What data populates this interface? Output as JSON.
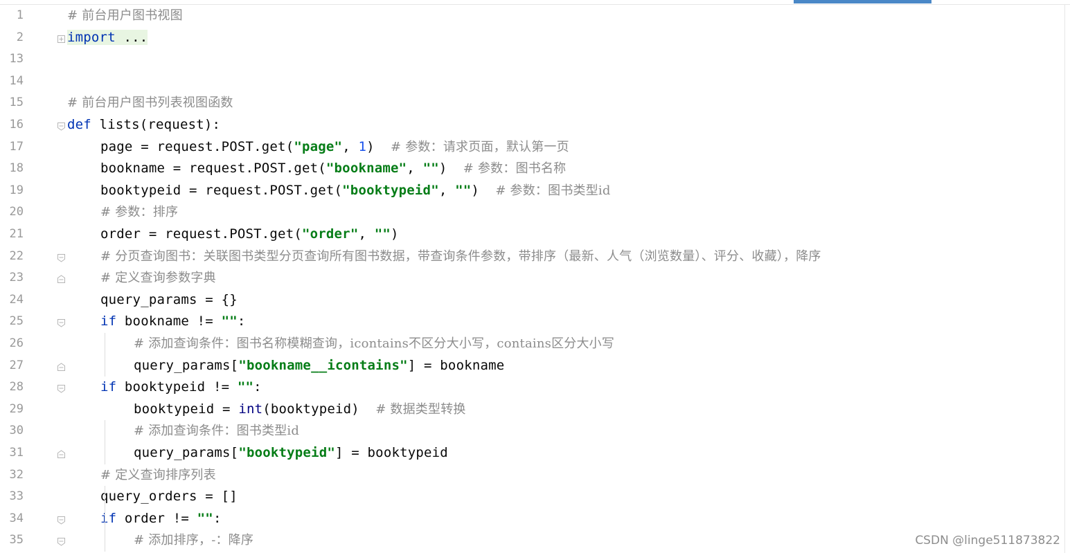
{
  "editor": {
    "lines": [
      {
        "num": "1",
        "fold": "",
        "indent": 0,
        "tokens": [
          {
            "t": "cm",
            "v": "# 前台用户图书视图"
          }
        ]
      },
      {
        "num": "2",
        "fold": "plus",
        "indent": 0,
        "hl": true,
        "tokens": [
          {
            "t": "kw",
            "v": "import"
          },
          {
            "t": "",
            "v": " ..."
          }
        ]
      },
      {
        "num": "13",
        "fold": "",
        "indent": 0,
        "tokens": []
      },
      {
        "num": "14",
        "fold": "",
        "indent": 0,
        "tokens": []
      },
      {
        "num": "15",
        "fold": "",
        "indent": 0,
        "tokens": [
          {
            "t": "cm",
            "v": "# 前台用户图书列表视图函数"
          }
        ]
      },
      {
        "num": "16",
        "fold": "open",
        "indent": 0,
        "tokens": [
          {
            "t": "kw",
            "v": "def"
          },
          {
            "t": "",
            "v": " lists(request):"
          }
        ]
      },
      {
        "num": "17",
        "fold": "",
        "indent": 1,
        "tokens": [
          {
            "t": "",
            "v": "page = request.POST.get("
          },
          {
            "t": "str",
            "v": "\"page\""
          },
          {
            "t": "",
            "v": ", "
          },
          {
            "t": "num",
            "v": "1"
          },
          {
            "t": "",
            "v": ")  "
          },
          {
            "t": "cm",
            "v": "# 参数：请求页面，默认第一页"
          }
        ]
      },
      {
        "num": "18",
        "fold": "",
        "indent": 1,
        "tokens": [
          {
            "t": "",
            "v": "bookname = request.POST.get("
          },
          {
            "t": "str",
            "v": "\"bookname\""
          },
          {
            "t": "",
            "v": ", "
          },
          {
            "t": "str",
            "v": "\"\""
          },
          {
            "t": "",
            "v": ")  "
          },
          {
            "t": "cm",
            "v": "# 参数：图书名称"
          }
        ]
      },
      {
        "num": "19",
        "fold": "",
        "indent": 1,
        "tokens": [
          {
            "t": "",
            "v": "booktypeid = request.POST.get("
          },
          {
            "t": "str",
            "v": "\"booktypeid\""
          },
          {
            "t": "",
            "v": ", "
          },
          {
            "t": "str",
            "v": "\"\""
          },
          {
            "t": "",
            "v": ")  "
          },
          {
            "t": "cm",
            "v": "# 参数：图书类型id"
          }
        ]
      },
      {
        "num": "20",
        "fold": "",
        "indent": 1,
        "tokens": [
          {
            "t": "cm",
            "v": "# 参数：排序"
          }
        ]
      },
      {
        "num": "21",
        "fold": "",
        "indent": 1,
        "tokens": [
          {
            "t": "",
            "v": "order = request.POST.get("
          },
          {
            "t": "str",
            "v": "\"order\""
          },
          {
            "t": "",
            "v": ", "
          },
          {
            "t": "str",
            "v": "\"\""
          },
          {
            "t": "",
            "v": ")"
          }
        ]
      },
      {
        "num": "22",
        "fold": "open",
        "indent": 1,
        "tokens": [
          {
            "t": "cm",
            "v": "# 分页查询图书：关联图书类型分页查询所有图书数据，带查询条件参数，带排序（最新、人气（浏览数量）、评分、收藏），降序"
          }
        ]
      },
      {
        "num": "23",
        "fold": "close",
        "indent": 1,
        "tokens": [
          {
            "t": "cm",
            "v": "# 定义查询参数字典"
          }
        ]
      },
      {
        "num": "24",
        "fold": "",
        "indent": 1,
        "tokens": [
          {
            "t": "",
            "v": "query_params = {}"
          }
        ]
      },
      {
        "num": "25",
        "fold": "open",
        "indent": 1,
        "tokens": [
          {
            "t": "kw",
            "v": "if"
          },
          {
            "t": "",
            "v": " bookname != "
          },
          {
            "t": "str",
            "v": "\"\""
          },
          {
            "t": "",
            "v": ":"
          }
        ]
      },
      {
        "num": "26",
        "fold": "",
        "indent": 2,
        "tokens": [
          {
            "t": "cm",
            "v": "# 添加查询条件：图书名称模糊查询，icontains不区分大小写，contains区分大小写"
          }
        ]
      },
      {
        "num": "27",
        "fold": "close",
        "indent": 2,
        "tokens": [
          {
            "t": "",
            "v": "query_params["
          },
          {
            "t": "str",
            "v": "\"bookname__icontains\""
          },
          {
            "t": "",
            "v": "] = bookname"
          }
        ]
      },
      {
        "num": "28",
        "fold": "open",
        "indent": 1,
        "tokens": [
          {
            "t": "kw",
            "v": "if"
          },
          {
            "t": "",
            "v": " booktypeid != "
          },
          {
            "t": "str",
            "v": "\"\""
          },
          {
            "t": "",
            "v": ":"
          }
        ]
      },
      {
        "num": "29",
        "fold": "",
        "indent": 2,
        "tokens": [
          {
            "t": "",
            "v": "booktypeid = "
          },
          {
            "t": "bi",
            "v": "int"
          },
          {
            "t": "",
            "v": "(booktypeid)  "
          },
          {
            "t": "cm",
            "v": "# 数据类型转换"
          }
        ]
      },
      {
        "num": "30",
        "fold": "",
        "indent": 2,
        "tokens": [
          {
            "t": "cm",
            "v": "# 添加查询条件：图书类型id"
          }
        ]
      },
      {
        "num": "31",
        "fold": "close",
        "indent": 2,
        "tokens": [
          {
            "t": "",
            "v": "query_params["
          },
          {
            "t": "str",
            "v": "\"booktypeid\""
          },
          {
            "t": "",
            "v": "] = booktypeid"
          }
        ]
      },
      {
        "num": "32",
        "fold": "",
        "indent": 1,
        "tokens": [
          {
            "t": "cm",
            "v": "# 定义查询排序列表"
          }
        ]
      },
      {
        "num": "33",
        "fold": "",
        "indent": 1,
        "tokens": [
          {
            "t": "",
            "v": "query_orders = []"
          }
        ]
      },
      {
        "num": "34",
        "fold": "open",
        "indent": 1,
        "tokens": [
          {
            "t": "kw",
            "v": "if"
          },
          {
            "t": "",
            "v": " order != "
          },
          {
            "t": "str",
            "v": "\"\""
          },
          {
            "t": "",
            "v": ":"
          }
        ]
      },
      {
        "num": "35",
        "fold": "open",
        "indent": 2,
        "tokens": [
          {
            "t": "cm",
            "v": "# 添加排序，-：降序"
          }
        ]
      }
    ]
  },
  "watermark": "CSDN @linge511873822"
}
